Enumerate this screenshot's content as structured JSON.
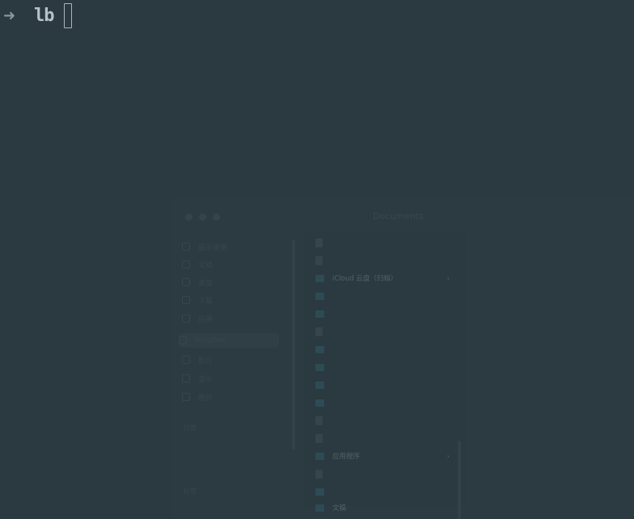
{
  "terminal": {
    "prompt_symbol": "➜",
    "command": "lb",
    "colors": {
      "background": "#2b3a40",
      "text": "#b7c2c6"
    }
  },
  "finder_window": {
    "title": "Documents",
    "sidebar": {
      "items": [
        {
          "label": "最近使用",
          "icon": "clock-icon"
        },
        {
          "label": "文稿",
          "icon": "doc-icon"
        },
        {
          "label": "桌面",
          "icon": "desktop-icon"
        },
        {
          "label": "下载",
          "icon": "download-icon"
        },
        {
          "label": "应用",
          "icon": "app-icon"
        },
        {
          "label": "Dropbox",
          "icon": "dropbox-icon",
          "selected": true
        },
        {
          "label": "影片",
          "icon": "film-icon"
        },
        {
          "label": "音乐",
          "icon": "music-icon"
        },
        {
          "label": "图片",
          "icon": "photo-icon"
        }
      ],
      "sections": [
        "位置",
        "标签"
      ]
    },
    "files": [
      {
        "name": "iCloud 云盘（归档）",
        "type": "folder",
        "highlight": true
      },
      {
        "name": "应用程序",
        "type": "folder",
        "highlight": true
      },
      {
        "name": "文稿",
        "type": "folder",
        "highlight": true
      }
    ]
  }
}
